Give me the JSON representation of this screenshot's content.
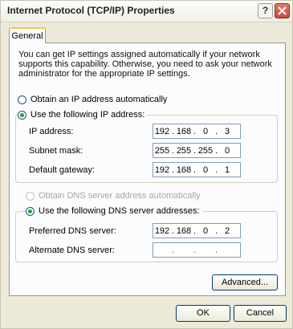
{
  "window": {
    "title": "Internet Protocol (TCP/IP) Properties",
    "help_label": "?",
    "close_icon": "close-icon"
  },
  "tabs": [
    {
      "label": "General"
    }
  ],
  "description": "You can get IP settings assigned automatically if your network supports this capability. Otherwise, you need to ask your network administrator for the appropriate IP settings.",
  "ip": {
    "auto_label": "Obtain an IP address automatically",
    "manual_label": "Use the following IP address:",
    "selected": "manual",
    "fields": [
      {
        "label": "IP address:",
        "octets": [
          "192",
          "168",
          "0",
          "3"
        ]
      },
      {
        "label": "Subnet mask:",
        "octets": [
          "255",
          "255",
          "255",
          "0"
        ]
      },
      {
        "label": "Default gateway:",
        "octets": [
          "192",
          "168",
          "0",
          "1"
        ]
      }
    ]
  },
  "dns": {
    "auto_label": "Obtain DNS server address automatically",
    "manual_label": "Use the following DNS server addresses:",
    "selected": "manual",
    "fields": [
      {
        "label": "Preferred DNS server:",
        "octets": [
          "192",
          "168",
          "0",
          "2"
        ]
      },
      {
        "label": "Alternate DNS server:",
        "octets": [
          "",
          "",
          "",
          ""
        ]
      }
    ]
  },
  "buttons": {
    "advanced": "Advanced...",
    "ok": "OK",
    "cancel": "Cancel"
  }
}
